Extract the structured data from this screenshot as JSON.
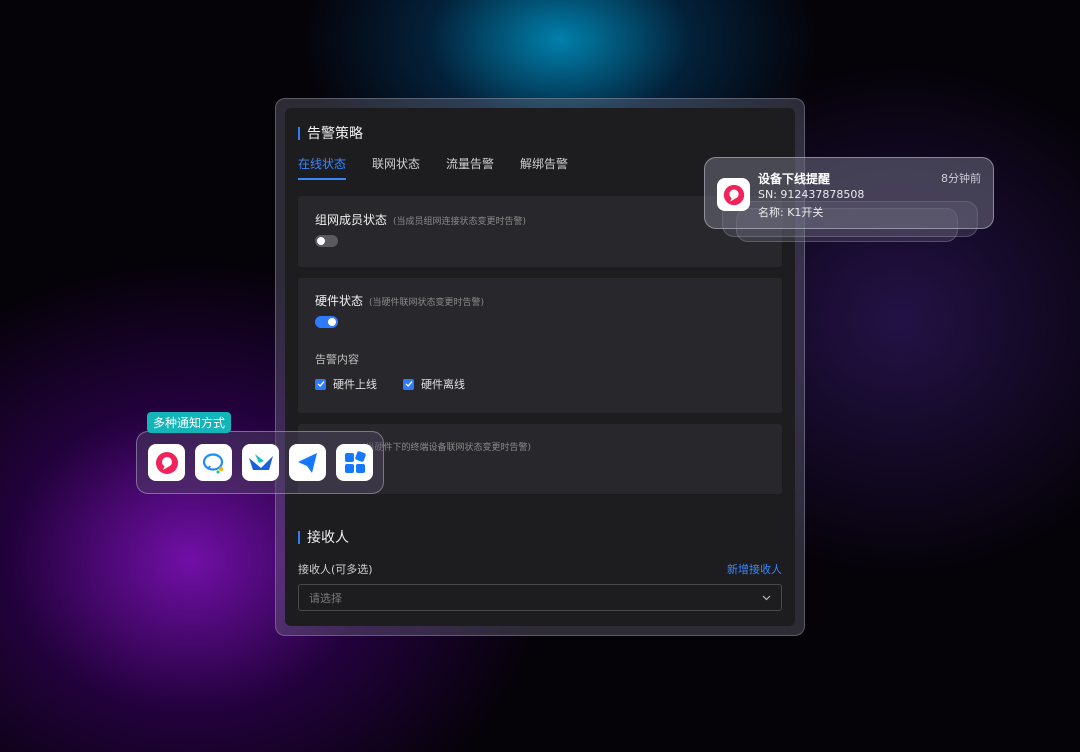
{
  "policy": {
    "title": "告警策略",
    "tabs": [
      "在线状态",
      "联网状态",
      "流量告警",
      "解绑告警"
    ],
    "active_tab": 0
  },
  "cards": {
    "group_member": {
      "title": "组网成员状态",
      "hint": "(当成员组网连接状态变更时告警)",
      "toggle": "off"
    },
    "hardware": {
      "title": "硬件状态",
      "hint": "(当硬件联网状态变更时告警)",
      "toggle": "on",
      "content_label": "告警内容",
      "options": [
        "硬件上线",
        "硬件离线"
      ]
    },
    "terminal": {
      "hint": "(当硬件下的终端设备联网状态变更时告警)"
    }
  },
  "receivers": {
    "title": "接收人",
    "label": "接收人(可多选)",
    "add_link": "新增接收人",
    "select_placeholder": "请选择"
  },
  "notify": {
    "label": "多种通知方式",
    "apps": [
      "app-red-icon",
      "chat-bubble-icon",
      "dingtalk-blue-icon",
      "feishu-icon",
      "grid-app-icon"
    ]
  },
  "toast": {
    "title": "设备下线提醒",
    "time": "8分钟前",
    "sn": "SN: 912437878508",
    "name": "名称: K1开关"
  },
  "colors": {
    "accent": "#2f7bff",
    "teal_badge": "#13b5b8",
    "app_red": "#f0245a"
  }
}
